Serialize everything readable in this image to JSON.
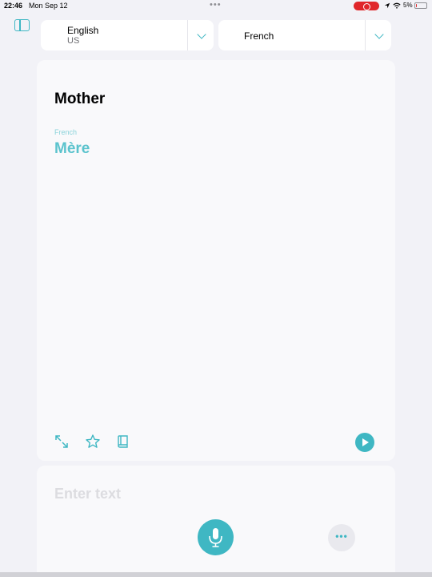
{
  "status_bar": {
    "time": "22:46",
    "date": "Mon Sep 12",
    "battery": "5%",
    "battery_level": 0.05,
    "icons": [
      "location-arrow-icon",
      "wifi-icon"
    ]
  },
  "language_selector": {
    "source": {
      "name": "English",
      "region": "US"
    },
    "target": {
      "name": "French"
    }
  },
  "translation": {
    "source_text": "Mother",
    "target_language_label": "French",
    "target_text": "Mère"
  },
  "toolbar": {
    "icons": [
      "expand-icon",
      "star-icon",
      "book-icon",
      "play-icon"
    ]
  },
  "input": {
    "placeholder": "Enter text",
    "value": ""
  },
  "colors": {
    "accent": "#3fb7c3",
    "accent_light": "#5bc3cd",
    "background": "#f2f2f7",
    "recording": "#e0262a"
  }
}
